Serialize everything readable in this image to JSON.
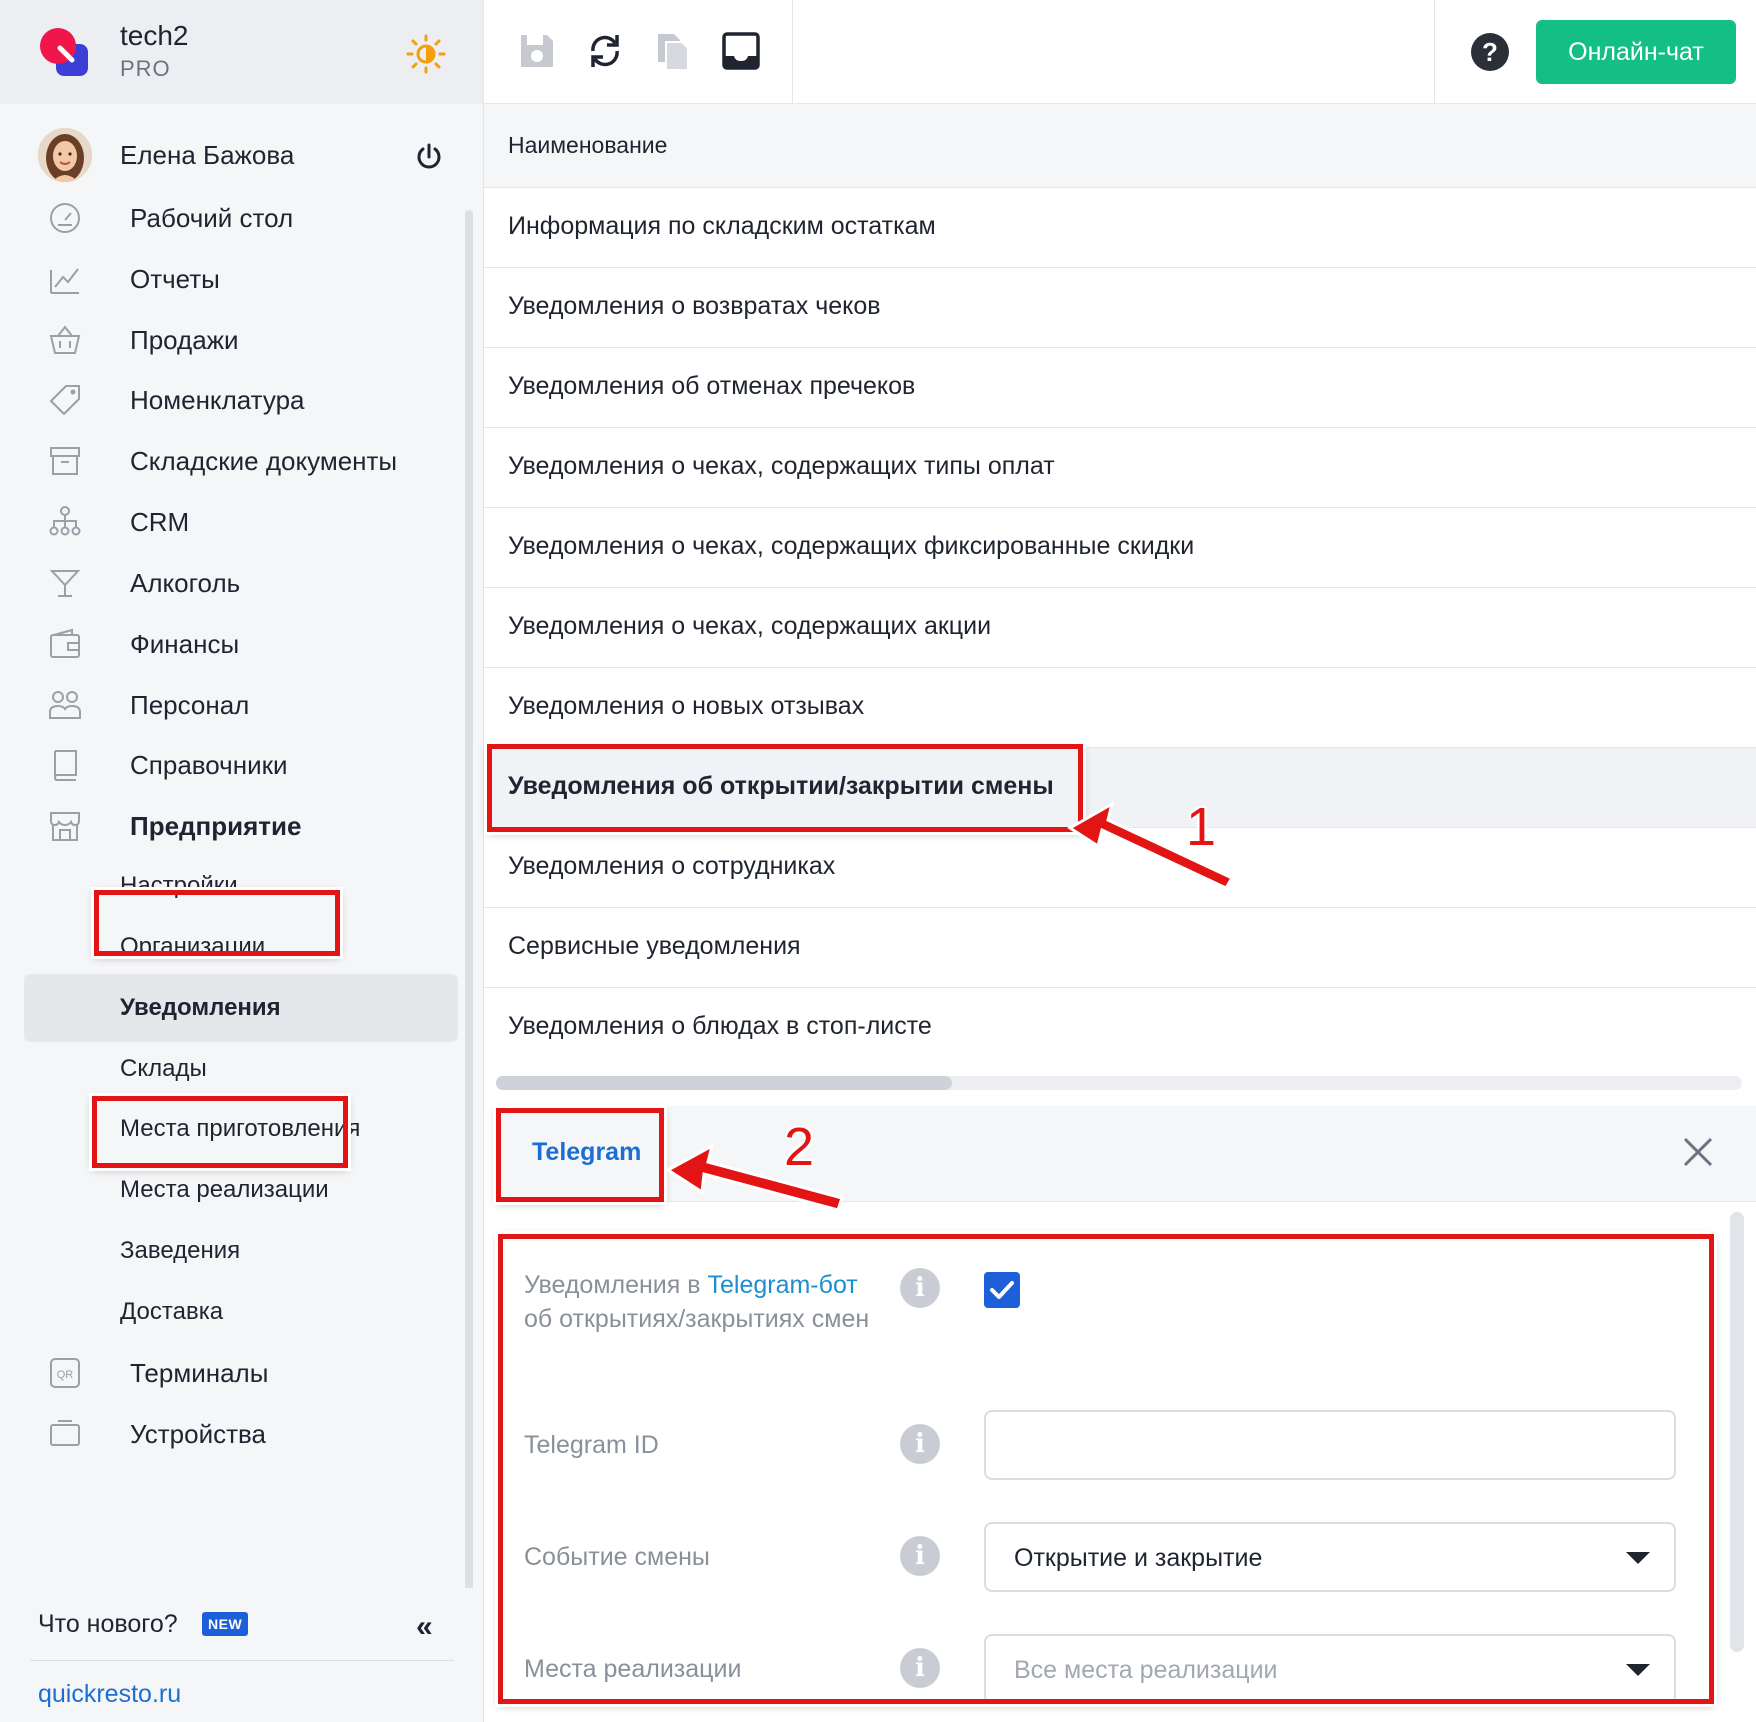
{
  "brand": {
    "name": "tech2",
    "plan": "PRO"
  },
  "user": {
    "name": "Елена Бажова"
  },
  "nav": {
    "items": [
      {
        "label": "Рабочий стол",
        "icon": "dashboard-icon"
      },
      {
        "label": "Отчеты",
        "icon": "chart-icon"
      },
      {
        "label": "Продажи",
        "icon": "basket-icon"
      },
      {
        "label": "Номенклатура",
        "icon": "tag-icon"
      },
      {
        "label": "Складские документы",
        "icon": "archive-icon"
      },
      {
        "label": "CRM",
        "icon": "org-chart-icon"
      },
      {
        "label": "Алкоголь",
        "icon": "cocktail-icon"
      },
      {
        "label": "Финансы",
        "icon": "wallet-icon"
      },
      {
        "label": "Персонал",
        "icon": "people-icon"
      },
      {
        "label": "Справочники",
        "icon": "book-icon"
      },
      {
        "label": "Предприятие",
        "icon": "store-icon"
      }
    ],
    "sub": [
      "Настройки",
      "Организации",
      "Уведомления",
      "Склады",
      "Места приготовления",
      "Места реализации",
      "Заведения",
      "Доставка"
    ],
    "after": [
      {
        "label": "Терминалы",
        "icon": "qr-icon"
      },
      {
        "label": "Устройства",
        "icon": "device-icon"
      }
    ]
  },
  "footer": {
    "whats_new": "Что нового?",
    "badge": "NEW",
    "site": "quickresto.ru"
  },
  "toolbar": {
    "chat_label": "Онлайн-чат"
  },
  "table": {
    "header": "Наименование",
    "rows": [
      "Информация по складским остаткам",
      "Уведомления о возвратах чеков",
      "Уведомления об отменах пречеков",
      "Уведомления о чеках, содержащих типы оплат",
      "Уведомления о чеках, содержащих фиксированные скидки",
      "Уведомления о чеках, содержащих акции",
      "Уведомления о новых отзывах",
      "Уведомления об открытии/закрытии смены",
      "Уведомления о сотрудниках",
      "Сервисные уведомления",
      "Уведомления о блюдах в стоп-листе"
    ]
  },
  "panel": {
    "tab": "Telegram",
    "fields": {
      "notify_prefix": "Уведомления в ",
      "notify_link": "Telegram-бот",
      "notify_suffix": "об открытиях/закрытиях смен",
      "notify_checked": true,
      "telegram_id_label": "Telegram ID",
      "telegram_id_value": "",
      "event_label": "Событие смены",
      "event_value": "Открытие и закрытие",
      "places_label": "Места реализации",
      "places_placeholder": "Все места реализации"
    }
  },
  "annotations": {
    "one": "1",
    "two": "2"
  },
  "colors": {
    "accent": "#14bf85",
    "link": "#1c6fd1",
    "annotation": "#e21414",
    "checkbox": "#1c5fd9"
  }
}
